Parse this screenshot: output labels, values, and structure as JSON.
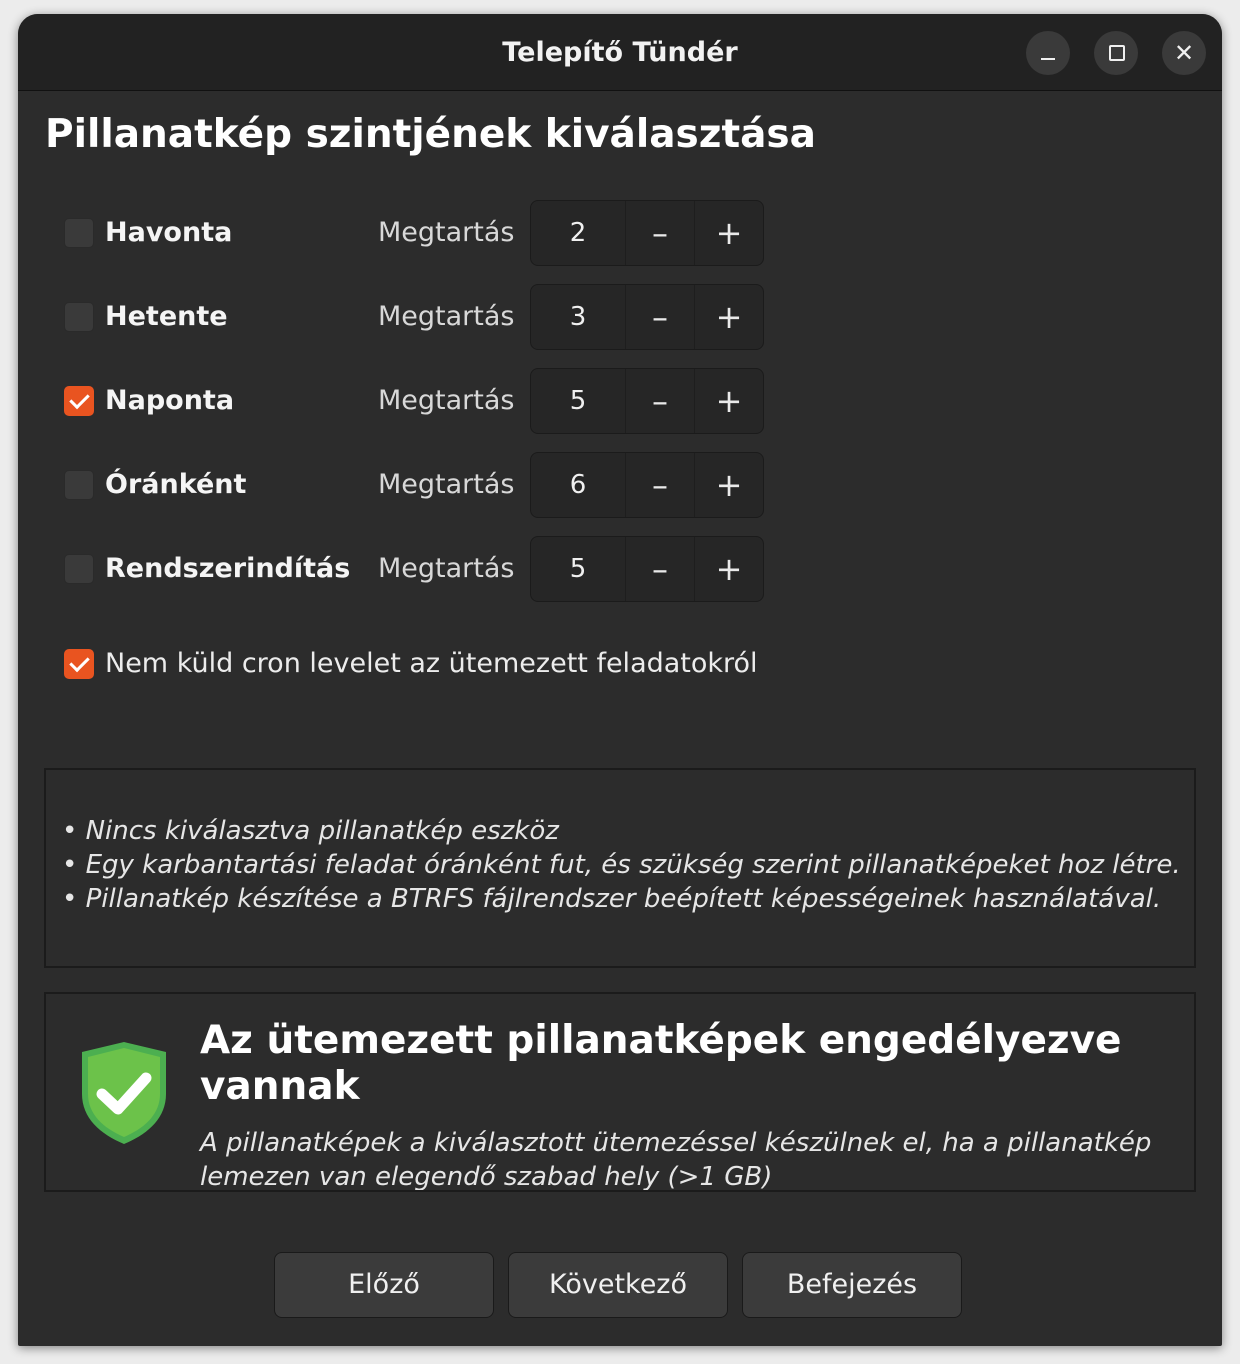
{
  "window": {
    "title": "Telepítő Tündér",
    "controls": {
      "minimize": "–",
      "maximize": "□",
      "close": "✕"
    }
  },
  "heading": "Pillanatkép szintjének kiválasztása",
  "levels": [
    {
      "label": "Havonta",
      "checked": false,
      "keep_label": "Megtartás",
      "value": "2",
      "minus": "–",
      "plus": "+"
    },
    {
      "label": "Hetente",
      "checked": false,
      "keep_label": "Megtartás",
      "value": "3",
      "minus": "–",
      "plus": "+"
    },
    {
      "label": "Naponta",
      "checked": true,
      "keep_label": "Megtartás",
      "value": "5",
      "minus": "–",
      "plus": "+"
    },
    {
      "label": "Óránként",
      "checked": false,
      "keep_label": "Megtartás",
      "value": "6",
      "minus": "–",
      "plus": "+"
    },
    {
      "label": "Rendszerindítás",
      "checked": false,
      "keep_label": "Megtartás",
      "value": "5",
      "minus": "–",
      "plus": "+"
    }
  ],
  "cron": {
    "label": "Nem küld cron levelet az ütemezett feladatokról",
    "checked": true
  },
  "info": [
    "• Nincs kiválasztva pillanatkép eszköz",
    "• Egy karbantartási feladat óránként fut, és szükség szerint pillanatképeket hoz létre.",
    "• Pillanatkép készítése a BTRFS fájlrendszer beépített képességeinek használatával."
  ],
  "status": {
    "icon": "shield-check-icon",
    "title": "Az ütemezett pillanatképek engedélyezve vannak",
    "description": "A pillanatképek a kiválasztott ütemezéssel készülnek el, ha a pillanatkép lemezen van elegendő szabad hely (>1 GB)",
    "color": "#6cc24a"
  },
  "buttons": {
    "prev": "Előző",
    "next": "Következő",
    "finish": "Befejezés"
  },
  "colors": {
    "accent": "#e95420",
    "background": "#2c2c2c",
    "titlebar": "#222222"
  }
}
